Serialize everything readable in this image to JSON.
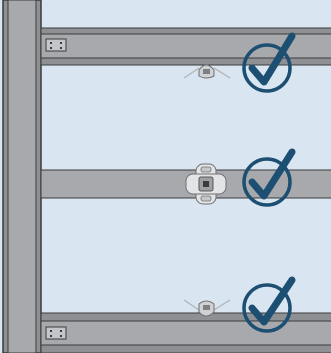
{
  "diagram": {
    "background_color": "#d9e6f1",
    "steel_fill": "#a7a9ac",
    "steel_shade": "#8e9093",
    "steel_edge": "#3a3b3d",
    "check_color": "#1c4f72",
    "rows": [
      {
        "name": "top",
        "status": "approved",
        "fastener": "clip-side-view",
        "icon": "checkmark-circle-icon"
      },
      {
        "name": "middle",
        "status": "approved",
        "fastener": "clip-top-view",
        "icon": "checkmark-circle-icon"
      },
      {
        "name": "bottom",
        "status": "approved",
        "fastener": "clip-side-view",
        "icon": "checkmark-circle-icon"
      }
    ]
  }
}
